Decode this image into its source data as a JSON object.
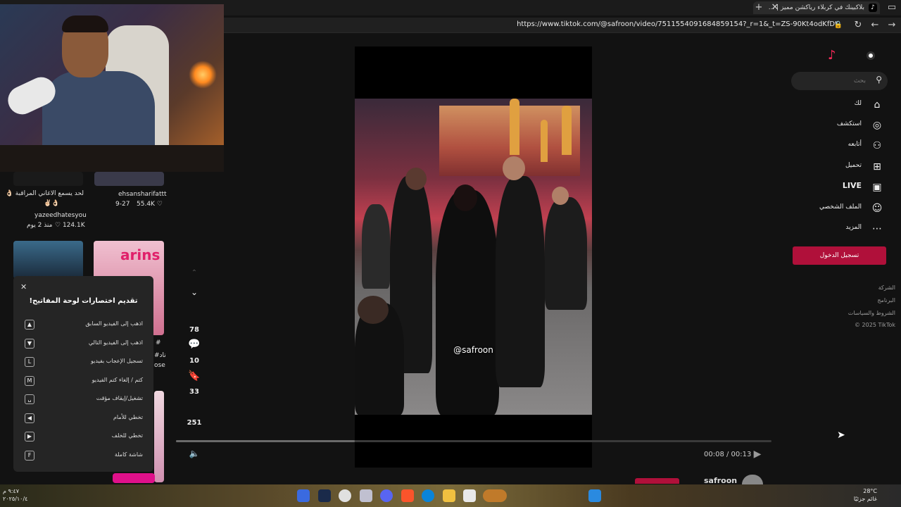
{
  "browser": {
    "tab_title": "بلاكبينك في كربلاء رياكشن مميز | ...",
    "url": "https://www.tiktok.com/@safroon/video/7511554091684859154?_r=1&_t=ZS-90Kt4odKfDt"
  },
  "feed": {
    "item1_caption": "لحد يسمع الاغاني المراقبة 👌🏻",
    "item1_caption2": "✌🏻👌🏻",
    "item1_user": "yazeedhatesyou",
    "item1_likes": "124.1K",
    "item1_age": "منذ 2 يوم",
    "item2_user": "ehsansharifattt",
    "item2_date": "9-27",
    "item2_likes": "55.4K",
    "item4_thumb_text": "arins",
    "item4_side_text": "#",
    "item4_side_text2": "#ناد",
    "item4_side_text3": "ose"
  },
  "shortcuts": {
    "title": "تقديم اختصارات لوحة المفاتيح!",
    "items": [
      {
        "key": "▲",
        "label": "اذهب إلى الفيديو السابق"
      },
      {
        "key": "▼",
        "label": "اذهب إلى الفيديو التالي"
      },
      {
        "key": "L",
        "label": "تسجيل الإعجاب بفيديو"
      },
      {
        "key": "M",
        "label": "كتم / إلغاء كتم الفيديو"
      },
      {
        "key": "␣",
        "label": "تشغيل/إيقاف مؤقت"
      },
      {
        "key": "◀",
        "label": "تخطي للأمام"
      },
      {
        "key": "▶",
        "label": "تخطي للخلف"
      },
      {
        "key": "F",
        "label": "شاشة كاملة"
      }
    ]
  },
  "actions": {
    "likes": "78",
    "comments": "10",
    "saves": "33",
    "shares": "251"
  },
  "video": {
    "watermark": "@safroon",
    "time": "00:08 / 00:13",
    "progress": 0.3,
    "author": "safroon"
  },
  "sidebar": {
    "search_placeholder": "بحث",
    "nav": [
      {
        "label": "لك",
        "icon": "⌂",
        "name": "home"
      },
      {
        "label": "استكشف",
        "icon": "◎",
        "name": "explore"
      },
      {
        "label": "أتابعه",
        "icon": "⚇",
        "name": "following"
      },
      {
        "label": "تحميل",
        "icon": "⊞",
        "name": "upload"
      },
      {
        "label": "LIVE",
        "icon": "▣",
        "name": "live"
      },
      {
        "label": "الملف الشخصي",
        "icon": "☺",
        "name": "profile"
      },
      {
        "label": "المزيد",
        "icon": "⋯",
        "name": "more"
      }
    ],
    "login_label": "تسجيل الدخول",
    "footer": [
      "الشركة",
      "البرنامج",
      "الشروط والسياسات",
      "© 2025 TikTok"
    ]
  },
  "taskbar": {
    "weather_temp": "28°C",
    "weather_desc": "غائم جزئيًا",
    "clock_time": "٩:٤٧ م",
    "clock_date": "٢٠٢٥/١٠/٤"
  },
  "colors": {
    "accent": "#b0103a",
    "background": "#121212"
  }
}
